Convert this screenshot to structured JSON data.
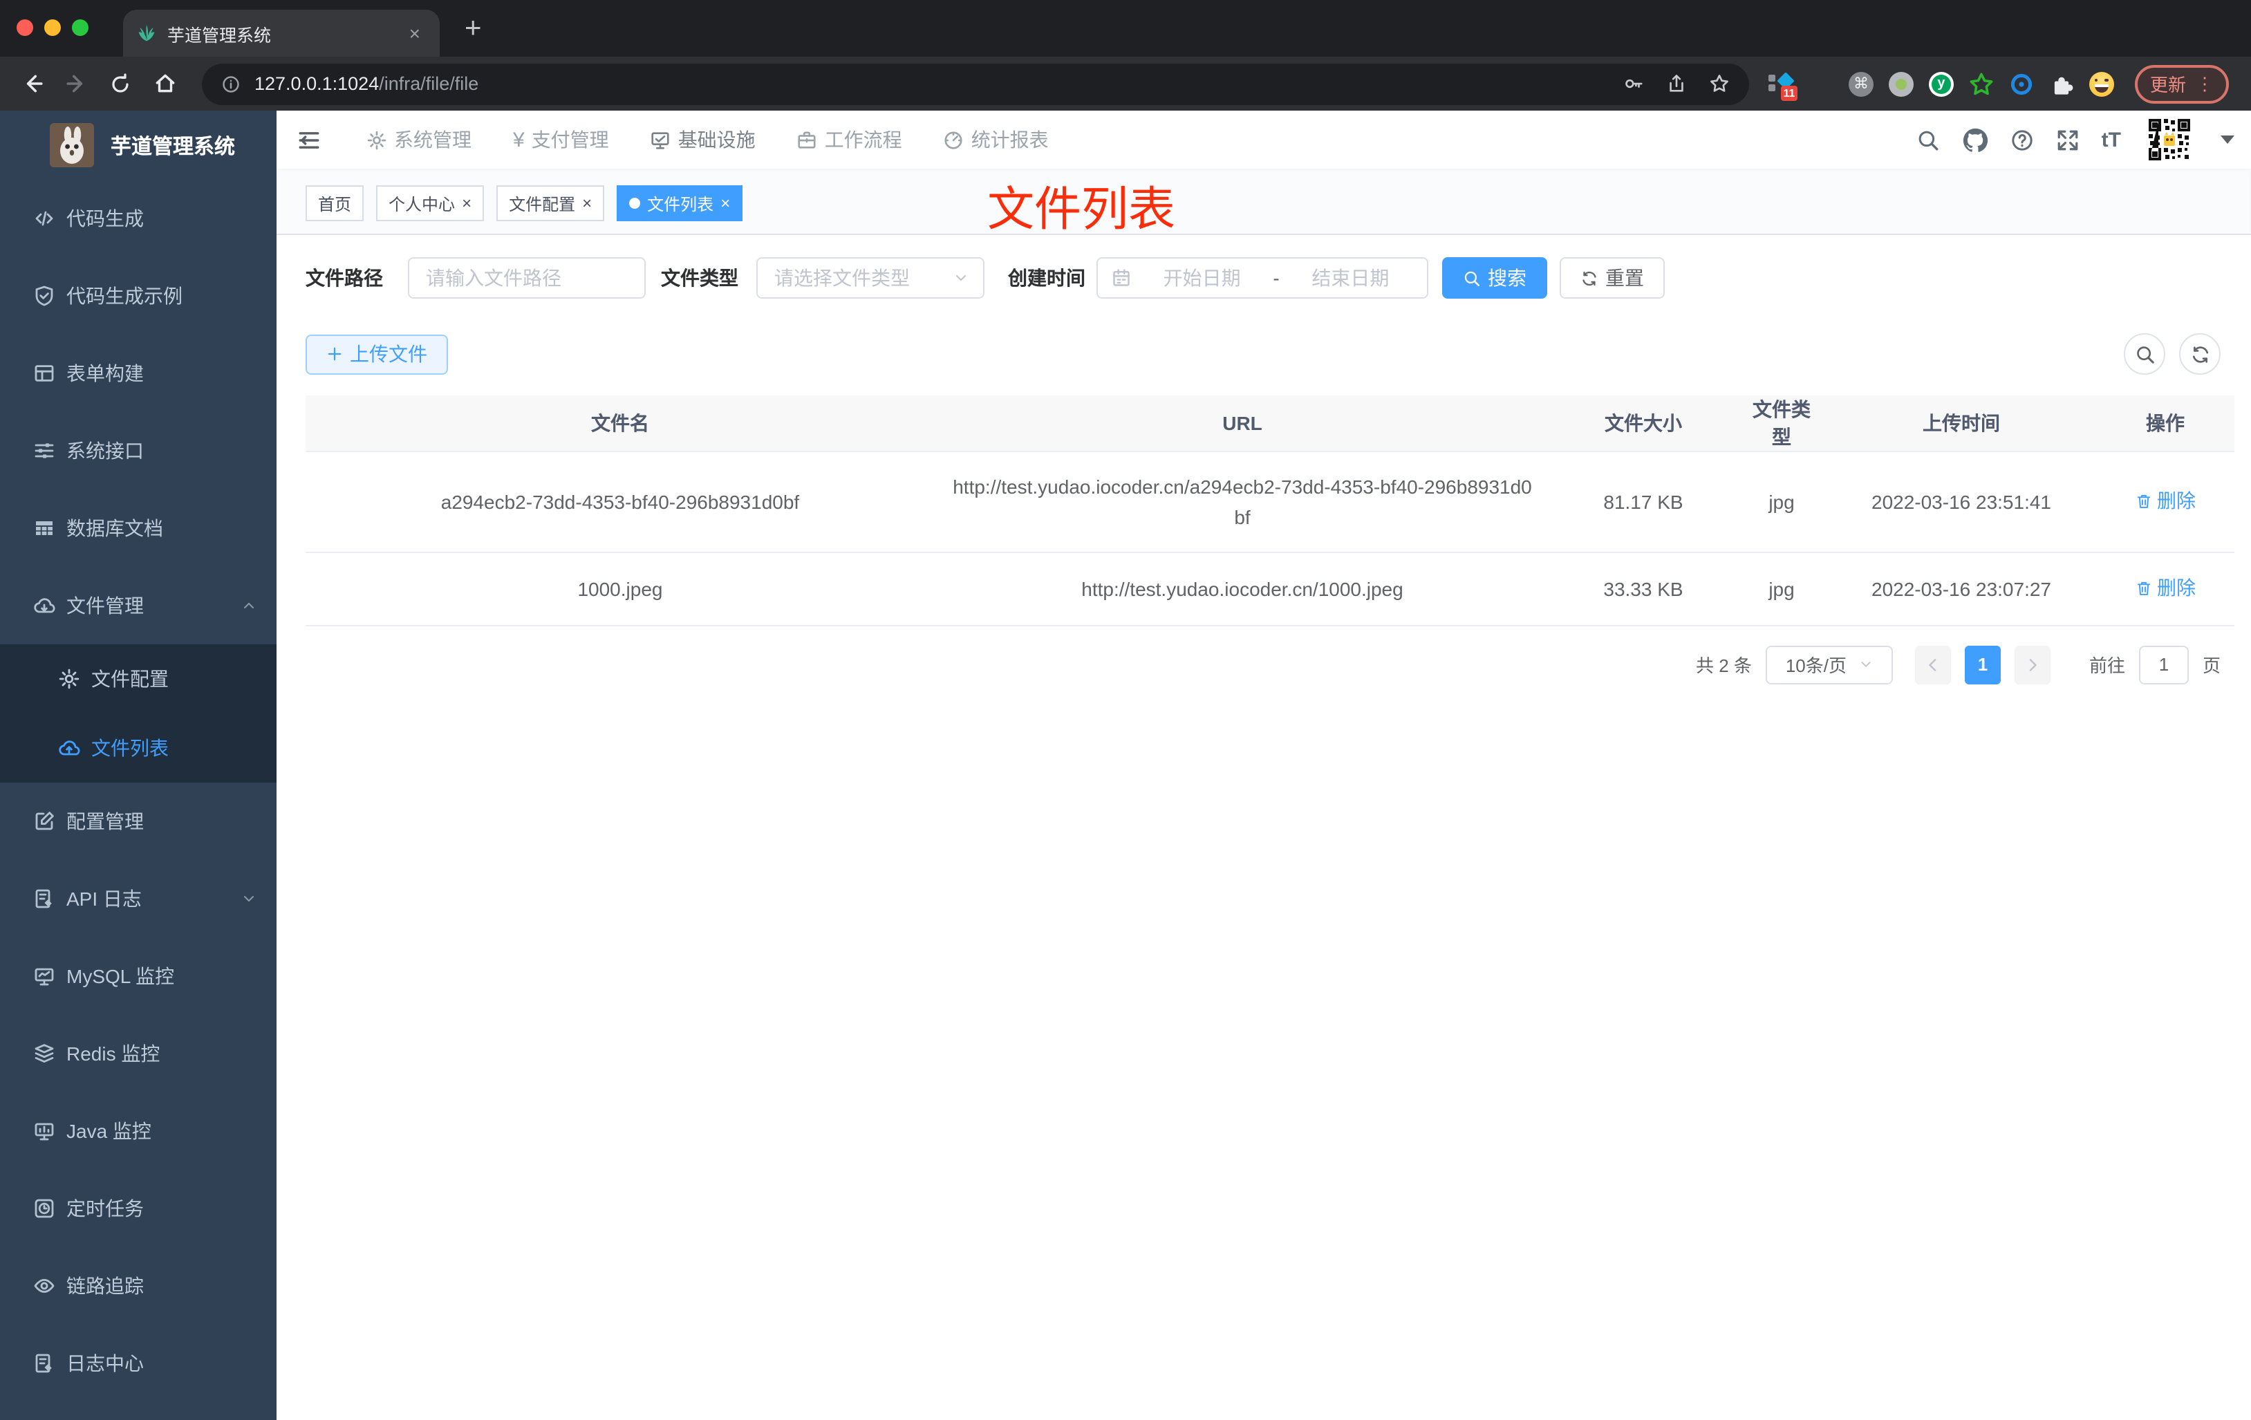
{
  "colors": {
    "accent": "#409eff",
    "annotation_red": "#f92d09",
    "sidebar_bg": "#304156",
    "submenu_bg": "#1f2d3d",
    "traffic_red": "#ff5f57",
    "traffic_yellow": "#febc2e",
    "traffic_green": "#28c840"
  },
  "glyphs": {
    "close": "×",
    "new_tab": "+",
    "command": "⌘",
    "kebab": "⋮",
    "letter_y": "y",
    "yen": "¥",
    "text_size": "tT",
    "question": "?"
  },
  "browser": {
    "tab": {
      "title": "芋道管理系统",
      "favicon": "plant-icon"
    },
    "toolbar": {
      "url_host": "127.0.0.1:1024",
      "url_path": "/infra/file/file"
    },
    "extensions": {
      "badge": "11",
      "update_label": "更新"
    }
  },
  "sidebar": {
    "title": "芋道管理系统",
    "items": [
      {
        "label": "代码生成",
        "icon": "code-icon"
      },
      {
        "label": "代码生成示例",
        "icon": "shield-check-icon"
      },
      {
        "label": "表单构建",
        "icon": "form-icon"
      },
      {
        "label": "系统接口",
        "icon": "sliders-icon"
      },
      {
        "label": "数据库文档",
        "icon": "database-table-icon"
      },
      {
        "label": "文件管理",
        "icon": "cloud-download-icon",
        "expanded": true,
        "children": [
          {
            "label": "文件配置",
            "icon": "gear-icon",
            "active": false
          },
          {
            "label": "文件列表",
            "icon": "cloud-upload-icon",
            "active": true
          }
        ]
      },
      {
        "label": "配置管理",
        "icon": "edit-square-icon"
      },
      {
        "label": "API 日志",
        "icon": "log-edit-icon",
        "collapsed": true
      },
      {
        "label": "MySQL 监控",
        "icon": "monitor-chart-icon"
      },
      {
        "label": "Redis 监控",
        "icon": "layers-icon"
      },
      {
        "label": "Java 监控",
        "icon": "monitor-icon"
      },
      {
        "label": "定时任务",
        "icon": "timer-icon"
      },
      {
        "label": "链路追踪",
        "icon": "eye-icon"
      },
      {
        "label": "日志中心",
        "icon": "log-center-icon"
      }
    ]
  },
  "topnav": {
    "items": [
      {
        "label": "系统管理",
        "icon": "gear-icon"
      },
      {
        "label": "支付管理",
        "icon": "yen-icon"
      },
      {
        "label": "基础设施",
        "icon": "monitor-check-icon",
        "active": true
      },
      {
        "label": "工作流程",
        "icon": "briefcase-icon"
      },
      {
        "label": "统计报表",
        "icon": "dashboard-icon"
      }
    ],
    "right_icons": [
      "search-icon",
      "github-icon",
      "help-icon",
      "fullscreen-icon",
      "font-size-icon",
      "qr-avatar",
      "caret-down-icon"
    ]
  },
  "tags": {
    "items": [
      {
        "label": "首页",
        "closable": false,
        "active": false
      },
      {
        "label": "个人中心",
        "closable": true,
        "active": false
      },
      {
        "label": "文件配置",
        "closable": true,
        "active": false
      },
      {
        "label": "文件列表",
        "closable": true,
        "active": true
      }
    ]
  },
  "annotation": {
    "text": "文件列表"
  },
  "filters": {
    "path": {
      "label": "文件路径",
      "placeholder": "请输入文件路径"
    },
    "type": {
      "label": "文件类型",
      "placeholder": "请选择文件类型"
    },
    "date": {
      "label": "创建时间",
      "start": "开始日期",
      "separator": "-",
      "end": "结束日期"
    },
    "search": "搜索",
    "reset": "重置"
  },
  "toolbar": {
    "upload": "上传文件"
  },
  "table": {
    "columns": [
      "文件名",
      "URL",
      "文件大小",
      "文件类型",
      "上传时间",
      "操作"
    ],
    "rows": [
      {
        "name": "a294ecb2-73dd-4353-bf40-296b8931d0bf",
        "url": "http://test.yudao.iocoder.cn/a294ecb2-73dd-4353-bf40-296b8931d0bf",
        "size": "81.17 KB",
        "type": "jpg",
        "time": "2022-03-16 23:51:41",
        "action": "删除"
      },
      {
        "name": "1000.jpeg",
        "url": "http://test.yudao.iocoder.cn/1000.jpeg",
        "size": "33.33 KB",
        "type": "jpg",
        "time": "2022-03-16 23:07:27",
        "action": "删除"
      }
    ]
  },
  "pagination": {
    "total": "共 2 条",
    "page_size": "10条/页",
    "current": "1",
    "goto_label": "前往",
    "goto_value": "1",
    "page_unit": "页"
  }
}
